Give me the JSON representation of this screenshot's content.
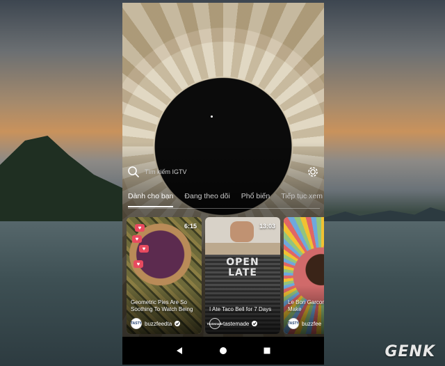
{
  "watermark": {
    "brand": "GENK"
  },
  "search": {
    "placeholder": "Tìm kiếm IGTV"
  },
  "tabs": [
    {
      "label": "Dành cho bạn",
      "active": true
    },
    {
      "label": "Đang theo dõi",
      "active": false
    },
    {
      "label": "Phổ biến",
      "active": false
    },
    {
      "label": "Tiếp tục xem",
      "active": false
    }
  ],
  "videos": [
    {
      "duration": "6:15",
      "title": "Geometric Pies Are So Soothing To Watch Being",
      "channel": "buzzfeedta",
      "avatar_text": "TASTY",
      "verified": true
    },
    {
      "duration": "13:03",
      "title": "I Ate Taco Bell for 7 Days",
      "channel": "tastemade",
      "avatar_text": "Tastemade",
      "verified": true,
      "thumb_text": "OPEN LATE"
    },
    {
      "duration": "",
      "title": "Le Bon Garcon That Will Make",
      "channel": "buzzfee",
      "avatar_text": "TASTY",
      "verified": false
    }
  ],
  "colors": {
    "accent": "#ffffff",
    "heart": "#e84a5f",
    "navbar": "#000000"
  },
  "icons": [
    "search-icon",
    "settings-icon",
    "heart-icon",
    "verified-icon",
    "back-icon",
    "home-icon",
    "recents-icon"
  ]
}
